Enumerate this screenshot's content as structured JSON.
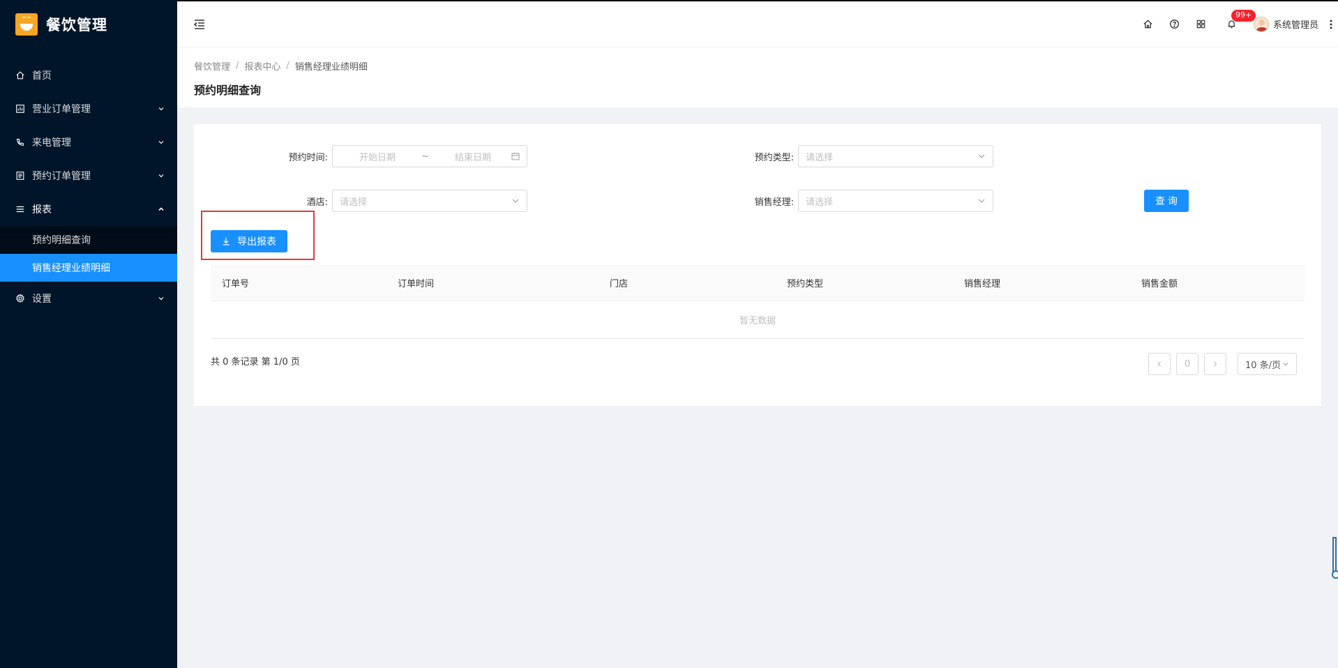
{
  "app": {
    "title": "餐饮管理",
    "colors": {
      "sidebar": "#001529",
      "primary": "#1890ff",
      "highlight": "#e53935",
      "logo": "#f5a623"
    }
  },
  "sidebar": {
    "items": [
      {
        "label": "首页",
        "icon": "home-icon"
      },
      {
        "label": "营业订单管理",
        "icon": "chart-icon",
        "expandable": true
      },
      {
        "label": "来电管理",
        "icon": "phone-icon",
        "expandable": true
      },
      {
        "label": "预约订单管理",
        "icon": "document-icon",
        "expandable": true
      },
      {
        "label": "报表",
        "icon": "menu-list-icon",
        "expandable": true,
        "open": true,
        "children": [
          {
            "label": "预约明细查询"
          },
          {
            "label": "销售经理业绩明细",
            "active": true
          }
        ]
      },
      {
        "label": "设置",
        "icon": "gear-icon",
        "expandable": true
      }
    ]
  },
  "header": {
    "notifications_badge": "99+",
    "user_name": "系统管理员"
  },
  "breadcrumb": [
    "餐饮管理",
    "报表中心",
    "销售经理业绩明细"
  ],
  "page_title": "预约明细查询",
  "form": {
    "reserve_time_label": "预约时间:",
    "start_date_placeholder": "开始日期",
    "range_sep": "~",
    "end_date_placeholder": "结束日期",
    "reserve_type_label": "预约类型:",
    "reserve_type_placeholder": "请选择",
    "hotel_label": "酒店:",
    "hotel_placeholder": "请选择",
    "sales_manager_label": "销售经理:",
    "sales_manager_placeholder": "请选择",
    "query_button": "查 询",
    "export_button": "导出报表"
  },
  "table": {
    "columns": [
      "订单号",
      "订单时间",
      "门店",
      "预约类型",
      "销售经理",
      "销售金额"
    ],
    "rows": [],
    "empty_text": "暂无数据"
  },
  "pagination": {
    "summary": "共 0 条记录 第 1/0 页",
    "current_page": "0",
    "page_size": "10 条/页"
  }
}
